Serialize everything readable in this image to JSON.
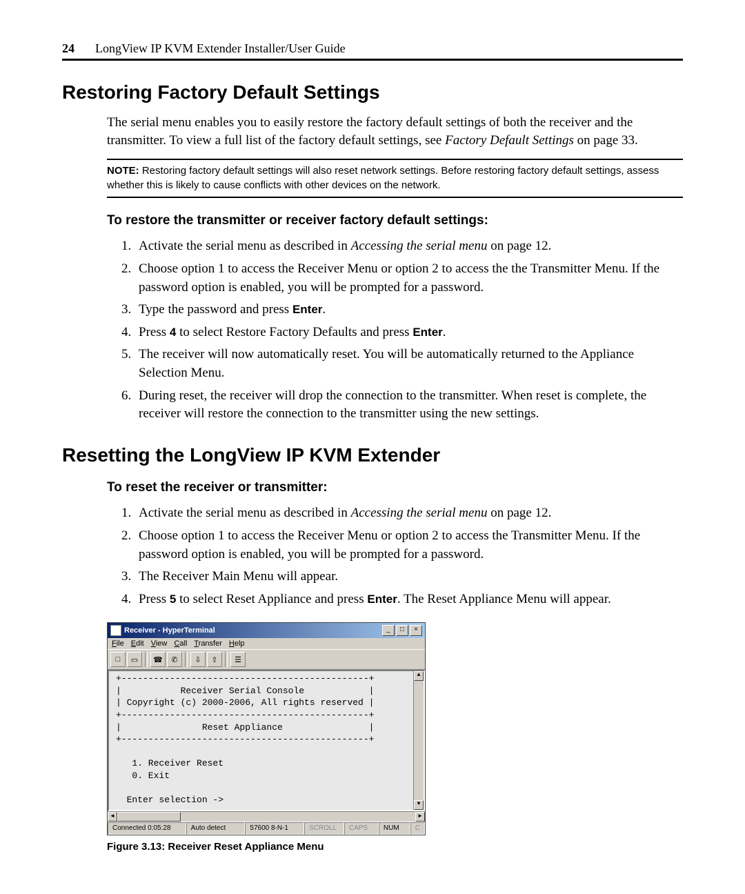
{
  "header": {
    "page_num": "24",
    "doc_title": "LongView IP KVM Extender Installer/User Guide"
  },
  "section1": {
    "heading": "Restoring Factory Default Settings",
    "intro_prefix": "The serial menu enables you to easily restore the factory default settings of both the receiver and the transmitter. To view a full list of the factory default settings, see ",
    "intro_ref": "Factory Default Settings",
    "intro_suffix": " on page 33.",
    "note_label": "NOTE:",
    "note_text": " Restoring factory default settings will also reset network settings. Before restoring factory default settings, assess whether this is likely to cause conflicts with other devices on the network.",
    "proc_heading": "To restore the transmitter or receiver factory default settings:",
    "steps": {
      "s1_prefix": "Activate the serial menu as described in ",
      "s1_ref": "Accessing the serial menu",
      "s1_suffix": " on page 12.",
      "s2": "Choose option 1 to access the Receiver Menu or option 2 to access the the Transmitter Menu. If the password option is enabled, you will be prompted for a password.",
      "s3_prefix": "Type the password and press ",
      "s3_key": "Enter",
      "s3_suffix": ".",
      "s4_prefix": "Press ",
      "s4_key": "4",
      "s4_mid": " to select Restore Factory Defaults and press ",
      "s4_key2": "Enter",
      "s4_suffix": ".",
      "s5": "The receiver will now automatically reset. You will be automatically returned to the Appliance Selection Menu.",
      "s6": "During reset, the receiver will drop the connection to the transmitter. When reset is complete, the receiver will restore the connection to the transmitter using the new settings."
    }
  },
  "section2": {
    "heading": "Resetting the LongView IP KVM Extender",
    "proc_heading": "To reset the receiver or transmitter:",
    "steps": {
      "s1_prefix": "Activate the serial menu as described in ",
      "s1_ref": "Accessing the serial menu",
      "s1_suffix": " on page 12.",
      "s2": "Choose option 1 to access the Receiver Menu or option 2 to access the Transmitter Menu. If the password option is enabled, you will be prompted for a password.",
      "s3": "The Receiver Main Menu will appear.",
      "s4_prefix": "Press ",
      "s4_key": "5",
      "s4_mid": " to select Reset Appliance and press ",
      "s4_key2": "Enter",
      "s4_suffix": ". The Reset Appliance Menu will appear."
    }
  },
  "hyperterminal": {
    "title": "Receiver - HyperTerminal",
    "menus": {
      "file": "File",
      "edit": "Edit",
      "view": "View",
      "call": "Call",
      "transfer": "Transfer",
      "help": "Help"
    },
    "terminal_text": "+----------------------------------------------+\n|           Receiver Serial Console            |\n| Copyright (c) 2000-2006, All rights reserved |\n+----------------------------------------------+\n|               Reset Appliance                |\n+----------------------------------------------+\n\n   1. Receiver Reset\n   0. Exit\n\n  Enter selection ->",
    "status": {
      "connected": "Connected 0:05:28",
      "detect": "Auto detect",
      "baud": "57600 8-N-1",
      "scroll": "SCROLL",
      "caps": "CAPS",
      "num": "NUM",
      "capture": "C"
    }
  },
  "figure_caption": "Figure 3.13: Receiver Reset Appliance Menu"
}
